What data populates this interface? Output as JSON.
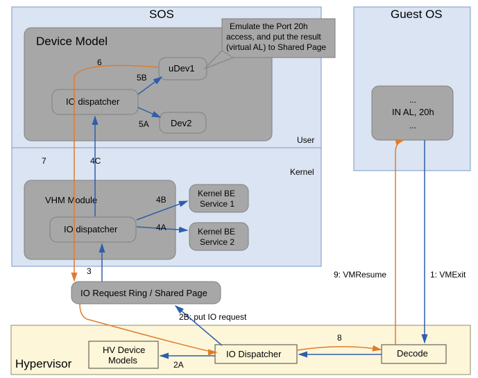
{
  "regions": {
    "sos": "SOS",
    "sos_user": "User",
    "sos_kernel": "Kernel",
    "guest": "Guest OS",
    "hyp": "Hypervisor"
  },
  "boxes": {
    "devModel": "Device Model",
    "ioDispDM": "IO dispatcher",
    "uDev1": "uDev1",
    "dev2": "Dev2",
    "vhm": "VHM Module",
    "ioDispVhm": "IO dispatcher",
    "kbe1a": "Kernel BE",
    "kbe1b": "Service 1",
    "kbe2a": "Kernel BE",
    "kbe2b": "Service 2",
    "ioReq": "IO Request Ring / Shared Page",
    "hvDev1": "HV Device",
    "hvDev2": "Models",
    "ioDispHV": "IO Dispatcher",
    "decode": "Decode",
    "guestCode1": "...",
    "guestCode2": "IN AL, 20h",
    "guestCode3": "..."
  },
  "callout": {
    "l1": "Emulate the Port 20h",
    "l2": "access, and put the result",
    "l3": "(virtual AL) to Shared Page"
  },
  "labels": {
    "n1": "1: VMExit",
    "n2a": "2A",
    "n2b": "2B: put IO request",
    "n3": "3",
    "n4a": "4A",
    "n4b": "4B",
    "n4c": "4C",
    "n5a": "5A",
    "n5b": "5B",
    "n6": "6",
    "n7": "7",
    "n8": "8",
    "n9": "9: VMResume"
  }
}
